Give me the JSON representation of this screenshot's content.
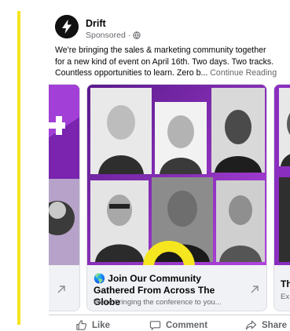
{
  "post": {
    "page_name": "Drift",
    "sponsored": "Sponsored · ",
    "text_lines": [
      "We're bringing the sales & marketing community together",
      "for a new kind of event on April 16th. Two days. Two tracks.",
      "Countless opportunities to learn. Zero b..."
    ],
    "continue_label": " Continue Reading"
  },
  "carousel": {
    "main_card": {
      "title_emoji": "🌎",
      "title": " Join Our Community Gathered From Across The Globe",
      "description": "We're bringing the conference to you..."
    },
    "right_card": {
      "title": "Th",
      "description": "Ex"
    }
  },
  "actions": {
    "like": "Like",
    "comment": "Comment",
    "share": "Share"
  },
  "colors": {
    "accent_bar": "#f5e61f",
    "brand_purple": "#8a2ebf",
    "brand_yellow": "#f5e61f",
    "muted_text": "#65676b"
  },
  "icons": [
    "drift-logo-icon",
    "globe-icon",
    "external-arrow-icon",
    "like-icon",
    "comment-icon",
    "share-icon"
  ]
}
